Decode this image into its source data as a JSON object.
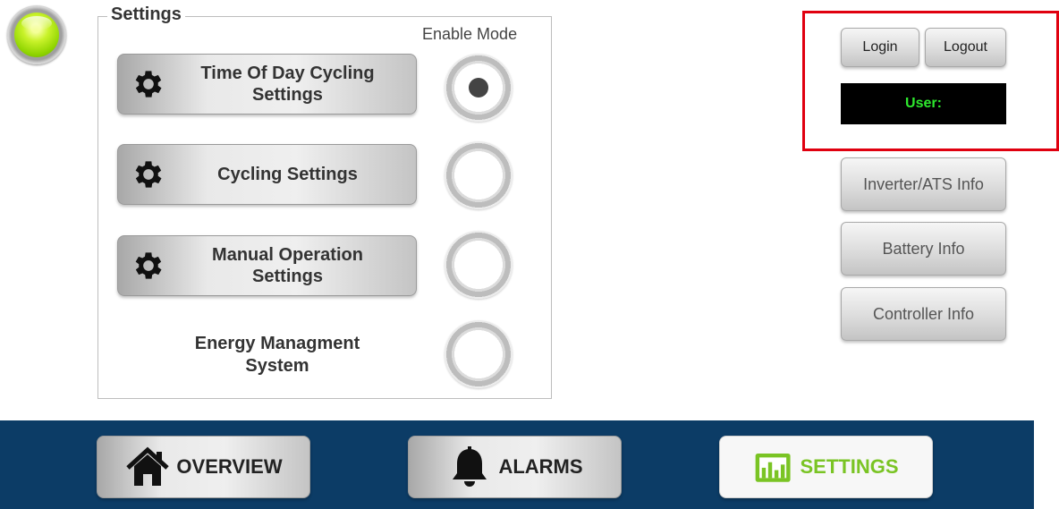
{
  "settings": {
    "title": "Settings",
    "enable_mode_label": "Enable Mode",
    "items": [
      {
        "label": "Time Of Day Cycling\nSettings",
        "icon": "gear-icon",
        "enabled": true
      },
      {
        "label": "Cycling Settings",
        "icon": "gear-icon",
        "enabled": false
      },
      {
        "label": "Manual Operation\nSettings",
        "icon": "gear-icon",
        "enabled": false
      }
    ],
    "ems": {
      "label": "Energy Managment\nSystem",
      "enabled": false
    }
  },
  "status_led": {
    "state": "ok",
    "color": "#9fe010"
  },
  "user_panel": {
    "login_label": "Login",
    "logout_label": "Logout",
    "user_label": "User:",
    "user_text_color": "#2ee82e",
    "highlight_color": "#e0000f"
  },
  "info_buttons": [
    {
      "label": "Inverter/ATS Info"
    },
    {
      "label": "Battery Info"
    },
    {
      "label": "Controller Info"
    }
  ],
  "nav": {
    "background": "#0c3c66",
    "items": [
      {
        "label": "OVERVIEW",
        "icon": "home-icon",
        "active": false
      },
      {
        "label": "ALARMS",
        "icon": "bell-icon",
        "active": false
      },
      {
        "label": "SETTINGS",
        "icon": "bar-chart-icon",
        "active": true,
        "color": "#7ac424"
      }
    ]
  }
}
